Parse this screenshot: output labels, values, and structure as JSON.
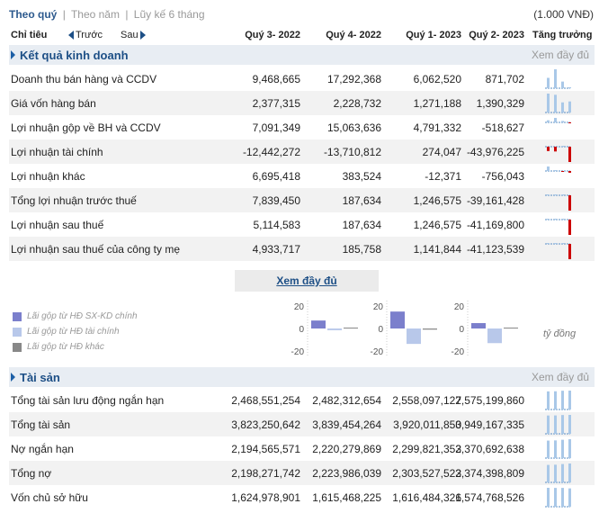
{
  "tabs": {
    "active": "Theo quý",
    "others": [
      "Theo năm",
      "Lũy kế 6 tháng"
    ],
    "separator": "|"
  },
  "unit": "(1.000 VNĐ)",
  "header": {
    "label": "Chỉ tiêu",
    "prev": "Trước",
    "next": "Sau",
    "periods": [
      "Quý 3- 2022",
      "Quý 4- 2022",
      "Quý 1- 2023",
      "Quý 2- 2023"
    ],
    "growth": "Tăng trưởng"
  },
  "income": {
    "title": "Kết quả kinh doanh",
    "more": "Xem đầy đủ",
    "rows": [
      {
        "label": "Doanh thu bán hàng và CCDV",
        "values": [
          "9,468,665",
          "17,292,368",
          "6,062,520",
          "871,702"
        ],
        "nums": [
          9468665,
          17292368,
          6062520,
          871702
        ]
      },
      {
        "label": "Giá vốn hàng bán",
        "values": [
          "2,377,315",
          "2,228,732",
          "1,271,188",
          "1,390,329"
        ],
        "nums": [
          2377315,
          2228732,
          1271188,
          1390329
        ]
      },
      {
        "label": "Lợi nhuận gộp về BH và CCDV",
        "values": [
          "7,091,349",
          "15,063,636",
          "4,791,332",
          "-518,627"
        ],
        "nums": [
          7091349,
          15063636,
          4791332,
          -518627
        ]
      },
      {
        "label": "Lợi nhuận tài chính",
        "values": [
          "-12,442,272",
          "-13,710,812",
          "274,047",
          "-43,976,225"
        ],
        "nums": [
          -12442272,
          -13710812,
          274047,
          -43976225
        ]
      },
      {
        "label": "Lợi nhuận khác",
        "values": [
          "6,695,418",
          "383,524",
          "-12,371",
          "-756,043"
        ],
        "nums": [
          6695418,
          383524,
          -12371,
          -756043
        ]
      },
      {
        "label": "Tổng lợi nhuận trước thuế",
        "values": [
          "7,839,450",
          "187,634",
          "1,246,575",
          "-39,161,428"
        ],
        "nums": [
          7839450,
          187634,
          1246575,
          -39161428
        ]
      },
      {
        "label": "Lợi nhuận sau thuế",
        "values": [
          "5,114,583",
          "187,634",
          "1,246,575",
          "-41,169,800"
        ],
        "nums": [
          5114583,
          187634,
          1246575,
          -41169800
        ]
      },
      {
        "label": "Lợi nhuận sau thuế của công ty mẹ",
        "values": [
          "4,933,717",
          "185,758",
          "1,141,844",
          "-41,123,539"
        ],
        "nums": [
          4933717,
          185758,
          1141844,
          -41123539
        ]
      }
    ]
  },
  "more_button": "Xem đầy đủ",
  "legend": [
    {
      "label": "Lãi gộp từ HĐ SX-KD chính",
      "color": "#7b7fcc"
    },
    {
      "label": "Lãi gộp từ HĐ tài chính",
      "color": "#b8c8ea"
    },
    {
      "label": "Lãi gộp từ HĐ khác",
      "color": "#888888"
    }
  ],
  "mini_charts": {
    "ticks": [
      "20",
      "0",
      "-20"
    ],
    "unit": "tỷ đồng",
    "groups": [
      {
        "values": [
          7.09,
          -1.5,
          0
        ]
      },
      {
        "values": [
          15.06,
          -13.71,
          -1.0
        ]
      },
      {
        "values": [
          4.79,
          -13.0,
          0
        ]
      }
    ]
  },
  "assets": {
    "title": "Tài sản",
    "more": "Xem đầy đủ",
    "rows": [
      {
        "label": "Tổng tài sản lưu động ngắn hạn",
        "values": [
          "2,468,551,254",
          "2,482,312,654",
          "2,558,097,127",
          "2,575,199,860"
        ],
        "nums": [
          2468551254,
          2482312654,
          2558097127,
          2575199860
        ]
      },
      {
        "label": "Tổng tài sản",
        "values": [
          "3,823,250,642",
          "3,839,454,264",
          "3,920,011,850",
          "3,949,167,335"
        ],
        "nums": [
          3823250642,
          3839454264,
          3920011850,
          3949167335
        ]
      },
      {
        "label": "Nợ ngắn hạn",
        "values": [
          "2,194,565,571",
          "2,220,279,869",
          "2,299,821,353",
          "2,370,692,638"
        ],
        "nums": [
          2194565571,
          2220279869,
          2299821353,
          2370692638
        ]
      },
      {
        "label": "Tổng nợ",
        "values": [
          "2,198,271,742",
          "2,223,986,039",
          "2,303,527,523",
          "2,374,398,809"
        ],
        "nums": [
          2198271742,
          2223986039,
          2303527523,
          2374398809
        ]
      },
      {
        "label": "Vốn chủ sở hữu",
        "values": [
          "1,624,978,901",
          "1,615,468,225",
          "1,616,484,326",
          "1,574,768,526"
        ],
        "nums": [
          1624978901,
          1615468225,
          1616484326,
          1574768526
        ]
      }
    ]
  },
  "colors": {
    "pos_bar": "#a9c8e8",
    "neg_bar": "#cc0000",
    "link": "#1d4f86",
    "section_bg": "#e8edf3"
  }
}
